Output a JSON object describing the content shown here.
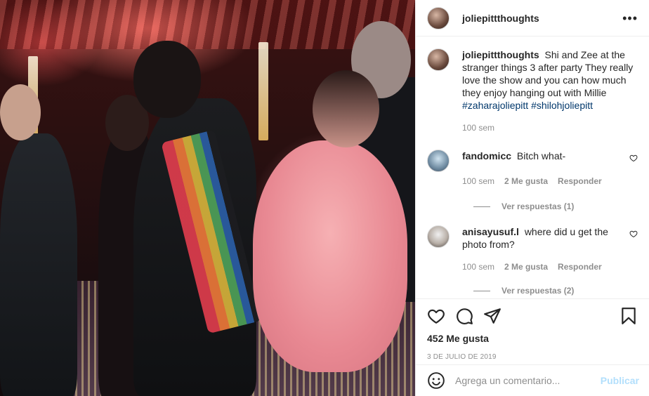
{
  "header": {
    "username": "joliepittthoughts",
    "more_icon": "more-horizontal-icon"
  },
  "caption": {
    "username": "joliepittthoughts",
    "text": "Shi and Zee at the stranger things 3 after party They really love the show and you can how much they enjoy hanging out with Millie",
    "hashtags": [
      "#zaharajoliepitt",
      "#shilohjoliepitt"
    ],
    "time": "100 sem"
  },
  "comments": [
    {
      "username": "fandomicc",
      "text": "Bitch what-",
      "time": "100 sem",
      "likes": "2 Me gusta",
      "reply_label": "Responder",
      "view_replies": "Ver respuestas (1)"
    },
    {
      "username": "anisayusuf.l",
      "text": "where did u get the photo from?",
      "time": "100 sem",
      "likes": "2 Me gusta",
      "reply_label": "Responder",
      "view_replies": "Ver respuestas (2)"
    }
  ],
  "actions": {
    "like_icon": "heart-icon",
    "comment_icon": "comment-icon",
    "share_icon": "share-icon",
    "save_icon": "bookmark-icon",
    "likes_count": "452 Me gusta",
    "date": "3 DE JULIO DE 2019"
  },
  "add_comment": {
    "emoji_icon": "emoji-icon",
    "placeholder": "Agrega un comentario...",
    "publish_label": "Publicar"
  },
  "colors": {
    "link": "#00376b",
    "publish_disabled": "#b2dffc",
    "secondary_text": "#8e8e8e"
  }
}
